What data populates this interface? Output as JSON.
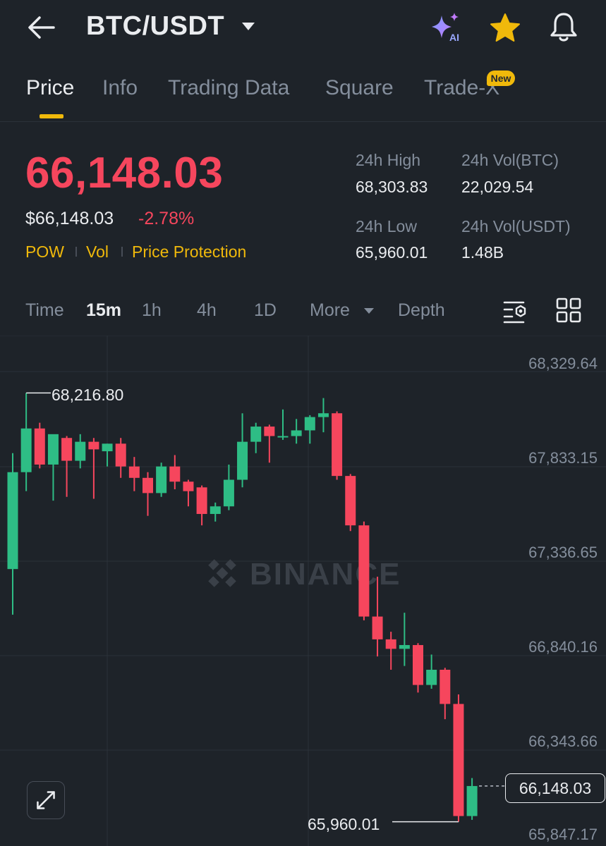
{
  "header": {
    "title": "BTC/USDT",
    "icons": [
      "back-icon",
      "caret-down-icon",
      "ai-sparkle-icon",
      "star-icon",
      "bell-icon"
    ],
    "ai_label": "AI"
  },
  "tabs": [
    {
      "label": "Price",
      "active": true
    },
    {
      "label": "Info",
      "active": false
    },
    {
      "label": "Trading Data",
      "active": false
    },
    {
      "label": "Square",
      "active": false
    },
    {
      "label": "Trade-X",
      "active": false,
      "badge": "New"
    }
  ],
  "price": {
    "last": "66,148.03",
    "fiat": "$66,148.03",
    "change": "-2.78%",
    "tags": [
      "POW",
      "Vol",
      "Price Protection"
    ]
  },
  "stats": {
    "high_label": "24h High",
    "high_value": "68,303.83",
    "vol_btc_label": "24h Vol(BTC)",
    "vol_btc_value": "22,029.54",
    "low_label": "24h Low",
    "low_value": "65,960.01",
    "vol_usdt_label": "24h Vol(USDT)",
    "vol_usdt_value": "1.48B"
  },
  "timeframes": {
    "items": [
      "Time",
      "15m",
      "1h",
      "4h",
      "1D",
      "More",
      "Depth"
    ],
    "active": "15m"
  },
  "chart": {
    "y_labels": [
      "68,329.64",
      "67,833.15",
      "67,336.65",
      "66,840.16",
      "66,343.66",
      "65,847.17"
    ],
    "high_marker": "68,216.80",
    "low_marker": "65,960.01",
    "current_price": "66,148.03",
    "watermark": "BINANCE",
    "colors": {
      "up": "#2ebd85",
      "down": "#f6465d",
      "accent": "#f0b90b"
    }
  },
  "chart_data": {
    "type": "candlestick",
    "ylim": [
      65847.17,
      68329.64
    ],
    "candles": [
      {
        "o": 67290,
        "h": 67900,
        "l": 67050,
        "c": 67800
      },
      {
        "o": 67800,
        "h": 68216.8,
        "l": 67700,
        "c": 68030
      },
      {
        "o": 68030,
        "h": 68060,
        "l": 67820,
        "c": 67840
      },
      {
        "o": 67840,
        "h": 67970,
        "l": 67650,
        "c": 68000
      },
      {
        "o": 67980,
        "h": 67990,
        "l": 67670,
        "c": 67860
      },
      {
        "o": 67860,
        "h": 68000,
        "l": 67820,
        "c": 67960
      },
      {
        "o": 67960,
        "h": 67980,
        "l": 67660,
        "c": 67920
      },
      {
        "o": 67910,
        "h": 67950,
        "l": 67830,
        "c": 67950
      },
      {
        "o": 67950,
        "h": 67980,
        "l": 67770,
        "c": 67830
      },
      {
        "o": 67830,
        "h": 67880,
        "l": 67700,
        "c": 67770
      },
      {
        "o": 67770,
        "h": 67800,
        "l": 67570,
        "c": 67690
      },
      {
        "o": 67690,
        "h": 67850,
        "l": 67670,
        "c": 67830
      },
      {
        "o": 67830,
        "h": 67890,
        "l": 67710,
        "c": 67750
      },
      {
        "o": 67750,
        "h": 67760,
        "l": 67620,
        "c": 67700
      },
      {
        "o": 67720,
        "h": 67730,
        "l": 67520,
        "c": 67580
      },
      {
        "o": 67580,
        "h": 67640,
        "l": 67540,
        "c": 67620
      },
      {
        "o": 67620,
        "h": 67840,
        "l": 67600,
        "c": 67760
      },
      {
        "o": 67760,
        "h": 68110,
        "l": 67720,
        "c": 67960
      },
      {
        "o": 67960,
        "h": 68060,
        "l": 67900,
        "c": 68040
      },
      {
        "o": 68040,
        "h": 68050,
        "l": 67850,
        "c": 67990
      },
      {
        "o": 67990,
        "h": 68130,
        "l": 67970,
        "c": 67990
      },
      {
        "o": 67990,
        "h": 68080,
        "l": 67950,
        "c": 68020
      },
      {
        "o": 68020,
        "h": 68100,
        "l": 67950,
        "c": 68090
      },
      {
        "o": 68090,
        "h": 68190,
        "l": 68010,
        "c": 68110
      },
      {
        "o": 68110,
        "h": 68120,
        "l": 67760,
        "c": 67780
      },
      {
        "o": 67780,
        "h": 67790,
        "l": 67490,
        "c": 67520
      },
      {
        "o": 67520,
        "h": 67540,
        "l": 67020,
        "c": 67040
      },
      {
        "o": 67040,
        "h": 67250,
        "l": 66830,
        "c": 66920
      },
      {
        "o": 66920,
        "h": 66960,
        "l": 66760,
        "c": 66870
      },
      {
        "o": 66870,
        "h": 67060,
        "l": 66780,
        "c": 66890
      },
      {
        "o": 66890,
        "h": 66900,
        "l": 66640,
        "c": 66680
      },
      {
        "o": 66680,
        "h": 66840,
        "l": 66660,
        "c": 66760
      },
      {
        "o": 66760,
        "h": 66770,
        "l": 66500,
        "c": 66580
      },
      {
        "o": 66580,
        "h": 66630,
        "l": 65960.01,
        "c": 65990
      },
      {
        "o": 65990,
        "h": 66190,
        "l": 65970,
        "c": 66148.03
      }
    ]
  }
}
